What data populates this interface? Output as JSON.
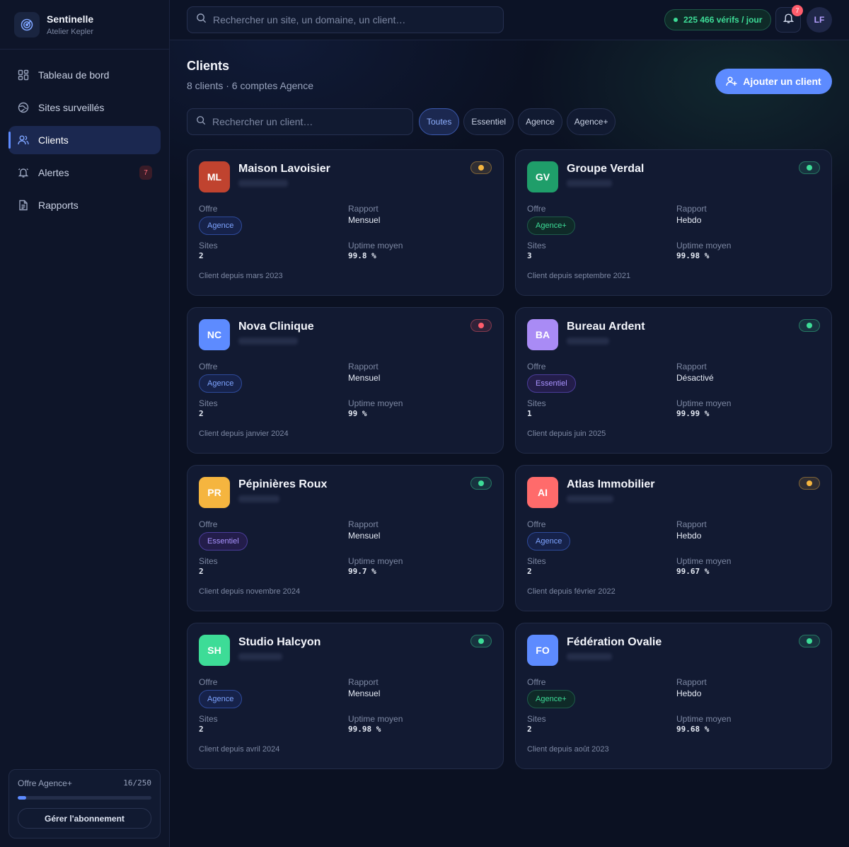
{
  "brand": {
    "name": "Sentinelle",
    "workspace": "Atelier Kepler"
  },
  "nav": [
    {
      "label": "Tableau de bord",
      "icon": "dashboard-icon",
      "active": false
    },
    {
      "label": "Sites surveillés",
      "icon": "globe-icon",
      "active": false
    },
    {
      "label": "Clients",
      "icon": "users-icon",
      "active": true
    },
    {
      "label": "Alertes",
      "icon": "bell-icon",
      "active": false,
      "badge": "7"
    },
    {
      "label": "Rapports",
      "icon": "document-icon",
      "active": false
    }
  ],
  "plan": {
    "name": "Offre Agence+",
    "usage": "16/250",
    "fill_fraction": 0.064,
    "button": "Gérer l'abonnement"
  },
  "topbar": {
    "search_placeholder": "Rechercher un site, un domaine, un client…",
    "verifs": "225 466 vérifs / jour",
    "notifications": "7",
    "user_initials": "LF"
  },
  "page": {
    "title": "Clients",
    "subtitle": "8 clients · 6 comptes Agence",
    "add_button": "Ajouter un client",
    "client_search_placeholder": "Rechercher un client…",
    "filters": [
      "Toutes",
      "Essentiel",
      "Agence",
      "Agence+"
    ],
    "active_filter": "Toutes"
  },
  "labels": {
    "offer": "Offre",
    "report": "Rapport",
    "sites": "Sites",
    "uptime": "Uptime moyen"
  },
  "colors": {
    "accent": "#5d8bff",
    "ok": "#3ddc97",
    "warn": "#f5b53f",
    "error": "#ff5d6c"
  },
  "clients": [
    {
      "initials": "ML",
      "name": "Maison Lavoisier",
      "color": "#c0432f",
      "status": "warn",
      "offer": "Agence",
      "report": "Mensuel",
      "sites": "2",
      "uptime": "99.8 %",
      "since": "Client depuis mars 2023"
    },
    {
      "initials": "GV",
      "name": "Groupe Verdal",
      "color": "#1f9e6a",
      "status": "ok",
      "offer": "Agence+",
      "report": "Hebdo",
      "sites": "3",
      "uptime": "99.98 %",
      "since": "Client depuis septembre 2021"
    },
    {
      "initials": "NC",
      "name": "Nova Clinique",
      "color": "#5d8bff",
      "status": "error",
      "offer": "Agence",
      "report": "Mensuel",
      "sites": "2",
      "uptime": "99 %",
      "since": "Client depuis janvier 2024"
    },
    {
      "initials": "BA",
      "name": "Bureau Ardent",
      "color": "#a98bf5",
      "status": "ok",
      "offer": "Essentiel",
      "report": "Désactivé",
      "sites": "1",
      "uptime": "99.99 %",
      "since": "Client depuis juin 2025"
    },
    {
      "initials": "PR",
      "name": "Pépinières Roux",
      "color": "#f5b53f",
      "status": "ok",
      "offer": "Essentiel",
      "report": "Mensuel",
      "sites": "2",
      "uptime": "99.7 %",
      "since": "Client depuis novembre 2024"
    },
    {
      "initials": "AI",
      "name": "Atlas Immobilier",
      "color": "#ff6b6b",
      "status": "warn",
      "offer": "Agence",
      "report": "Hebdo",
      "sites": "2",
      "uptime": "99.67 %",
      "since": "Client depuis février 2022"
    },
    {
      "initials": "SH",
      "name": "Studio Halcyon",
      "color": "#3ddc97",
      "status": "ok",
      "offer": "Agence",
      "report": "Mensuel",
      "sites": "2",
      "uptime": "99.98 %",
      "since": "Client depuis avril 2024"
    },
    {
      "initials": "FO",
      "name": "Fédération Ovalie",
      "color": "#5d8bff",
      "status": "ok",
      "offer": "Agence+",
      "report": "Hebdo",
      "sites": "2",
      "uptime": "99.68 %",
      "since": "Client depuis août 2023"
    }
  ]
}
